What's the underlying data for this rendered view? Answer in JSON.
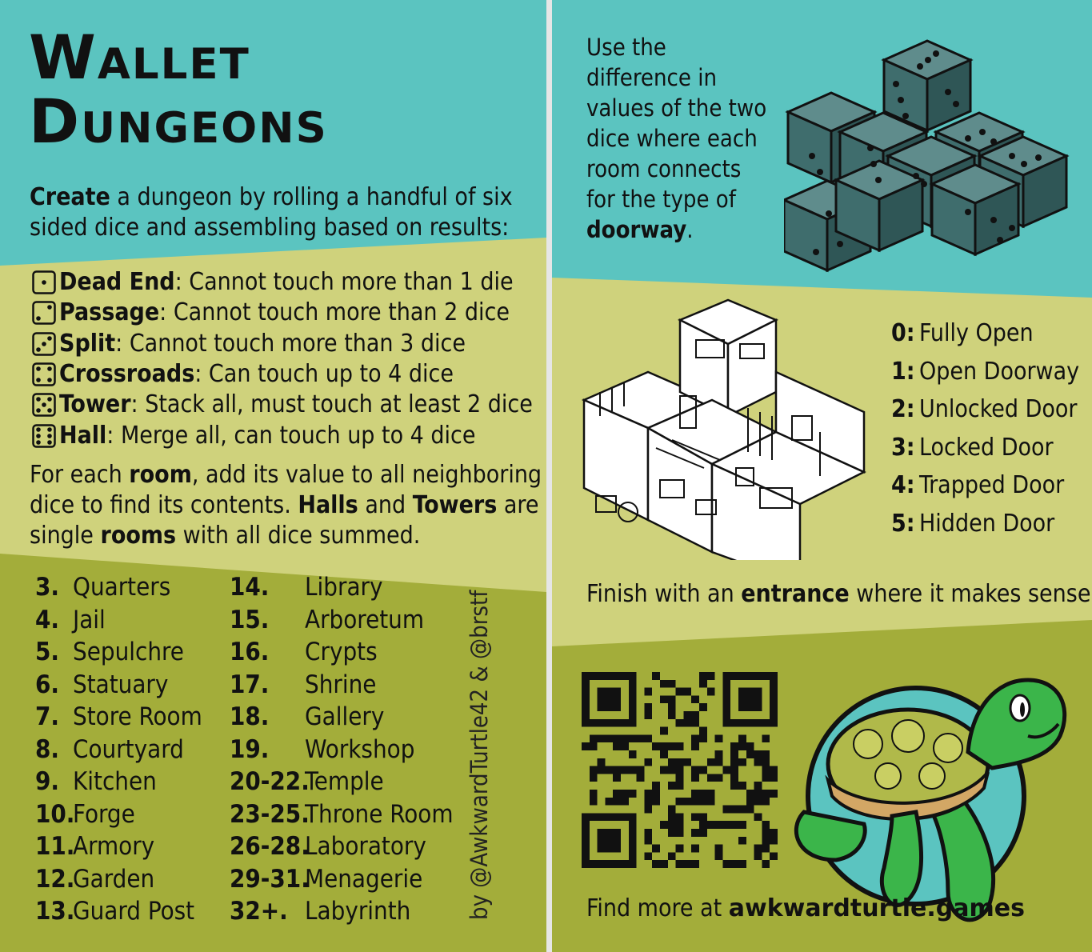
{
  "left": {
    "title_line1": "Wallet",
    "title_line2": "Dungeons",
    "intro_bold": "Create",
    "intro_line1_rest": " a dungeon by rolling a handful of six",
    "intro_line2": "sided dice and assembling based on results:",
    "rules": [
      {
        "pips": 1,
        "name": "Dead End",
        "text": ": Cannot touch more than 1 die"
      },
      {
        "pips": 2,
        "name": "Passage",
        "text": ": Cannot touch more than 2 dice"
      },
      {
        "pips": 3,
        "name": "Split",
        "text": ": Cannot touch more than 3 dice"
      },
      {
        "pips": 4,
        "name": "Crossroads",
        "text": ": Can touch up to 4 dice"
      },
      {
        "pips": 5,
        "name": "Tower",
        "text": ": Stack all, must touch at least 2 dice"
      },
      {
        "pips": 6,
        "name": "Hall",
        "text": ": Merge all, can touch up to 4 dice"
      }
    ],
    "room_p": {
      "l1a": "For each ",
      "l1b": "room",
      "l1c": ", add its value to all neighboring",
      "l2a": "dice to find its contents. ",
      "l2b": "Halls",
      "l2c": " and ",
      "l2d": "Towers",
      "l2e": " are",
      "l3a": "single ",
      "l3b": "rooms",
      "l3c": " with all dice summed."
    },
    "rooms_col1": [
      {
        "n": "3.",
        "r": "Quarters"
      },
      {
        "n": "4.",
        "r": "Jail"
      },
      {
        "n": "5.",
        "r": "Sepulchre"
      },
      {
        "n": "6.",
        "r": "Statuary"
      },
      {
        "n": "7.",
        "r": "Store Room"
      },
      {
        "n": "8.",
        "r": "Courtyard"
      },
      {
        "n": "9.",
        "r": "Kitchen"
      },
      {
        "n": "10.",
        "r": "Forge"
      },
      {
        "n": "11.",
        "r": "Armory"
      },
      {
        "n": "12.",
        "r": "Garden"
      },
      {
        "n": "13.",
        "r": "Guard Post"
      }
    ],
    "rooms_col2": [
      {
        "n": "14.",
        "r": "Library"
      },
      {
        "n": "15.",
        "r": "Arboretum"
      },
      {
        "n": "16.",
        "r": "Crypts"
      },
      {
        "n": "17.",
        "r": "Shrine"
      },
      {
        "n": "18.",
        "r": "Gallery"
      },
      {
        "n": "19.",
        "r": "Workshop"
      },
      {
        "n": "20-22.",
        "r": "Temple"
      },
      {
        "n": "23-25.",
        "r": "Throne Room"
      },
      {
        "n": "26-28.",
        "r": "Laboratory"
      },
      {
        "n": "29-31.",
        "r": "Menagerie"
      },
      {
        "n": "32+.",
        "r": "Labyrinth"
      }
    ],
    "credit": "by @AwkwardTurtle42 & @brstf"
  },
  "right": {
    "door_intro": [
      "Use the",
      "difference in",
      "values of the two",
      "dice where each",
      "room connects",
      "for the type of"
    ],
    "door_intro_bold": "doorway",
    "door_intro_end": ".",
    "doors": [
      {
        "k": "0:",
        "v": "Fully Open"
      },
      {
        "k": "1:",
        "v": "Open Doorway"
      },
      {
        "k": "2:",
        "v": "Unlocked Door"
      },
      {
        "k": "3:",
        "v": "Locked Door"
      },
      {
        "k": "4:",
        "v": "Trapped Door"
      },
      {
        "k": "5:",
        "v": "Hidden Door"
      }
    ],
    "finish_a": "Finish with an ",
    "finish_b": "entrance",
    "finish_c": " where it makes sense.",
    "more_a": "Find more at ",
    "more_b": "awkwardturtle.games"
  },
  "colors": {
    "teal": "#5bc4c0",
    "light_olive": "#cfd27c",
    "olive": "#a3ad3a",
    "dice": "#2f5c5c",
    "turtle": "#3bb54a"
  }
}
